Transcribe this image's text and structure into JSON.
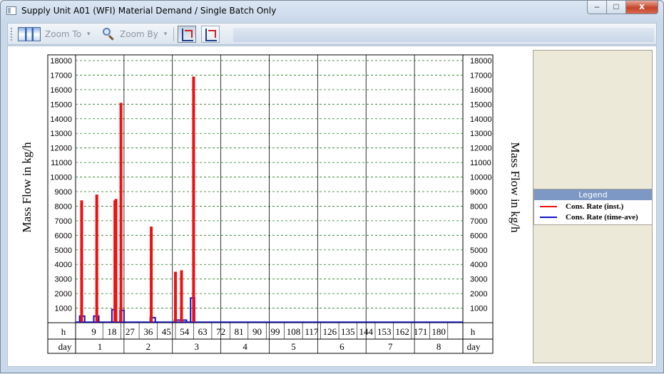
{
  "window": {
    "title": "Supply Unit A01 (WFI) Material Demand / Single Batch Only",
    "close_glyph": "x"
  },
  "toolbar": {
    "zoom_to_label": "Zoom To",
    "zoom_by_label": "Zoom By",
    "caret": "▾"
  },
  "legend": {
    "title": "Legend",
    "items": [
      {
        "label": "Cons. Rate (inst.)",
        "color": "#ee1111"
      },
      {
        "label": "Cons. Rate (time-ave)",
        "color": "#1111cc"
      }
    ]
  },
  "chart_data": {
    "type": "bar",
    "ylabel_left": "Mass Flow in kg/h",
    "ylabel_right": "Mass Flow in kg/h",
    "ylim": [
      0,
      18000
    ],
    "yticks": [
      1000,
      2000,
      3000,
      4000,
      5000,
      6000,
      7000,
      8000,
      9000,
      10000,
      11000,
      12000,
      13000,
      14000,
      15000,
      16000,
      17000,
      18000
    ],
    "xlim_h": [
      0,
      192
    ],
    "hour_row_label": "h",
    "day_row_label": "day",
    "hour_ticks": [
      9,
      18,
      27,
      36,
      45,
      54,
      63,
      72,
      81,
      90,
      99,
      108,
      117,
      126,
      135,
      144,
      153,
      162,
      171,
      180
    ],
    "days": [
      "1",
      "2",
      "3",
      "4",
      "5",
      "6",
      "7",
      "8"
    ],
    "grid": true,
    "legend_position": "right",
    "series": [
      {
        "name": "Cons. Rate (inst.)",
        "color": "#ee1111",
        "style": "bars",
        "bars": [
          {
            "x": 3,
            "y": 8400
          },
          {
            "x": 10.5,
            "y": 8800
          },
          {
            "x": 19.5,
            "y": 8400
          },
          {
            "x": 20,
            "y": 8500
          },
          {
            "x": 22.5,
            "y": 15100
          },
          {
            "x": 37.5,
            "y": 6600
          },
          {
            "x": 49.5,
            "y": 3500
          },
          {
            "x": 52.5,
            "y": 3600
          },
          {
            "x": 58.5,
            "y": 16900
          }
        ]
      },
      {
        "name": "Cons. Rate (time-ave)",
        "color": "#1111cc",
        "style": "step",
        "steps": [
          {
            "x0": 2,
            "x1": 4.5,
            "y": 450
          },
          {
            "x0": 9,
            "x1": 11.5,
            "y": 450
          },
          {
            "x0": 18,
            "x1": 20,
            "y": 900
          },
          {
            "x0": 22,
            "x1": 24,
            "y": 850
          },
          {
            "x0": 37,
            "x1": 39.5,
            "y": 350
          },
          {
            "x0": 49,
            "x1": 55,
            "y": 180
          },
          {
            "x0": 57,
            "x1": 59,
            "y": 1700
          }
        ]
      }
    ]
  }
}
